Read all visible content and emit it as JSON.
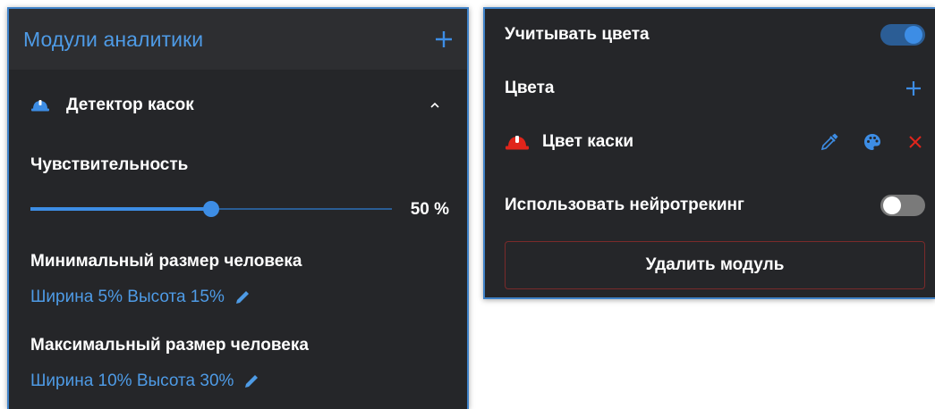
{
  "left_panel": {
    "title": "Модули аналитики",
    "add_icon": "plus-icon",
    "module": {
      "icon": "helmet-icon",
      "label": "Детектор касок",
      "expanded": true,
      "collapse_icon": "chevron-up-icon"
    },
    "sensitivity": {
      "label": "Чувствительность",
      "value": 50,
      "value_text": "50 %"
    },
    "min_size": {
      "label": "Минимальный размер человека",
      "value": "Ширина 5% Высота 15%",
      "edit_icon": "pencil-icon"
    },
    "max_size": {
      "label": "Максимальный размер человека",
      "value": "Ширина 10% Высота 30%",
      "edit_icon": "pencil-icon"
    }
  },
  "right_panel": {
    "use_colors": {
      "label": "Учитывать цвета",
      "on": true
    },
    "colors": {
      "label": "Цвета",
      "add_icon": "plus-icon"
    },
    "color_item": {
      "icon": "helmet-icon",
      "label": "Цвет каски",
      "icon_color": "#e0251b",
      "actions": [
        "eyedropper-icon",
        "palette-icon",
        "close-icon"
      ]
    },
    "neurotracking": {
      "label": "Использовать нейротрекинг",
      "on": false
    },
    "delete_button": "Удалить модуль"
  },
  "colors": {
    "accent": "#3d8de5",
    "link": "#4e9be6",
    "panel_bg": "#252629",
    "header_bg": "#2d2e31",
    "border": "#3f82c8",
    "danger": "#e0251b",
    "danger_border": "#7a2a2a"
  }
}
